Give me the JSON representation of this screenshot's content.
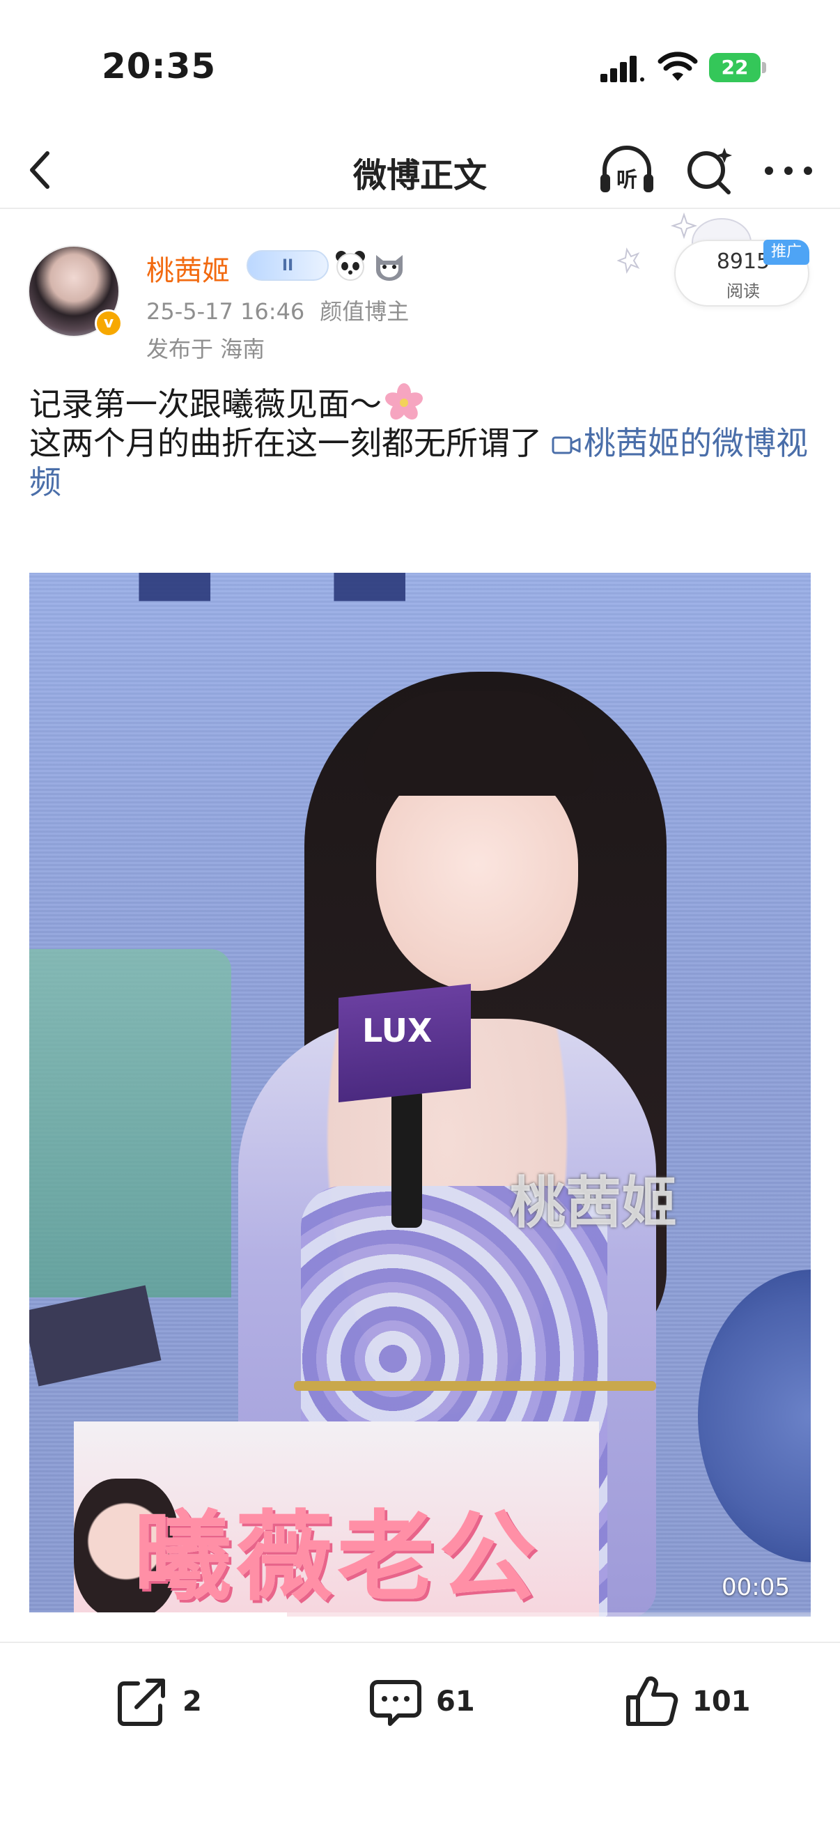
{
  "status_bar": {
    "time": "20:35",
    "battery": "22"
  },
  "nav": {
    "title": "微博正文",
    "listen_label": "听"
  },
  "author": {
    "name": "桃茜姬",
    "badge_text": "II",
    "date": "25-5-17 16:46",
    "tag": "颜值博主",
    "location": "发布于 海南",
    "verify_mark": "v"
  },
  "promo": {
    "read_count": "8915",
    "read_label": "阅读",
    "tag": "推广"
  },
  "post": {
    "line1": "记录第一次跟曦薇见面～",
    "line2": "这两个月的曲折在这一刻都无所谓了",
    "video_link": "桃茜姬的微博视频"
  },
  "video": {
    "duration": "00:05",
    "progress": 0.33,
    "brand": "LUX",
    "watermark": "桃茜姬",
    "sign_text": "曦薇老公"
  },
  "toolbar": {
    "shares": "2",
    "comments": "61",
    "likes": "101"
  },
  "colors": {
    "author_name": "#f26a10",
    "link": "#4a6ea9",
    "promo_tag": "#4ea4f5",
    "battery": "#34c759"
  }
}
